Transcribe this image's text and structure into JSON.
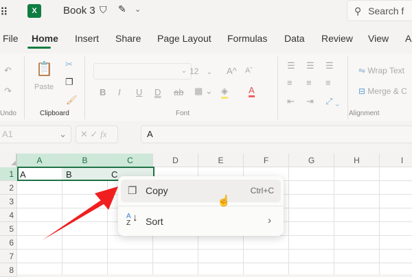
{
  "titlebar": {
    "doc_title": "Book 3",
    "search_placeholder": "Search f"
  },
  "tabs": [
    {
      "label": "File"
    },
    {
      "label": "Home",
      "active": true
    },
    {
      "label": "Insert"
    },
    {
      "label": "Share"
    },
    {
      "label": "Page Layout"
    },
    {
      "label": "Formulas"
    },
    {
      "label": "Data"
    },
    {
      "label": "Review"
    },
    {
      "label": "View"
    },
    {
      "label": "A"
    }
  ],
  "ribbon": {
    "undo_group": "Undo",
    "paste_label": "Paste",
    "clipboard_group": "Clipboard",
    "font_size": "12",
    "font_group": "Font",
    "wrap_text": "Wrap Text",
    "merge": "Merge & C",
    "alignment_group": "Alignment"
  },
  "formula_bar": {
    "name_box": "A1",
    "fx": "fx",
    "content": "A"
  },
  "columns": [
    "A",
    "B",
    "C",
    "D",
    "E",
    "F",
    "G",
    "H",
    "I"
  ],
  "rows": [
    "1",
    "2",
    "3",
    "4",
    "5",
    "6",
    "7",
    "8"
  ],
  "cells": {
    "A1": "A",
    "B1": "B",
    "C1": "C"
  },
  "context_menu": {
    "items": [
      {
        "label": "Copy",
        "shortcut": "Ctrl+C",
        "icon": "copy-icon"
      },
      {
        "label": "Sort",
        "icon": "sort-az-icon",
        "submenu": true
      }
    ]
  },
  "colors": {
    "accent": "#107c41",
    "selection": "#cde8d8",
    "arrow": "#f01e1e"
  }
}
